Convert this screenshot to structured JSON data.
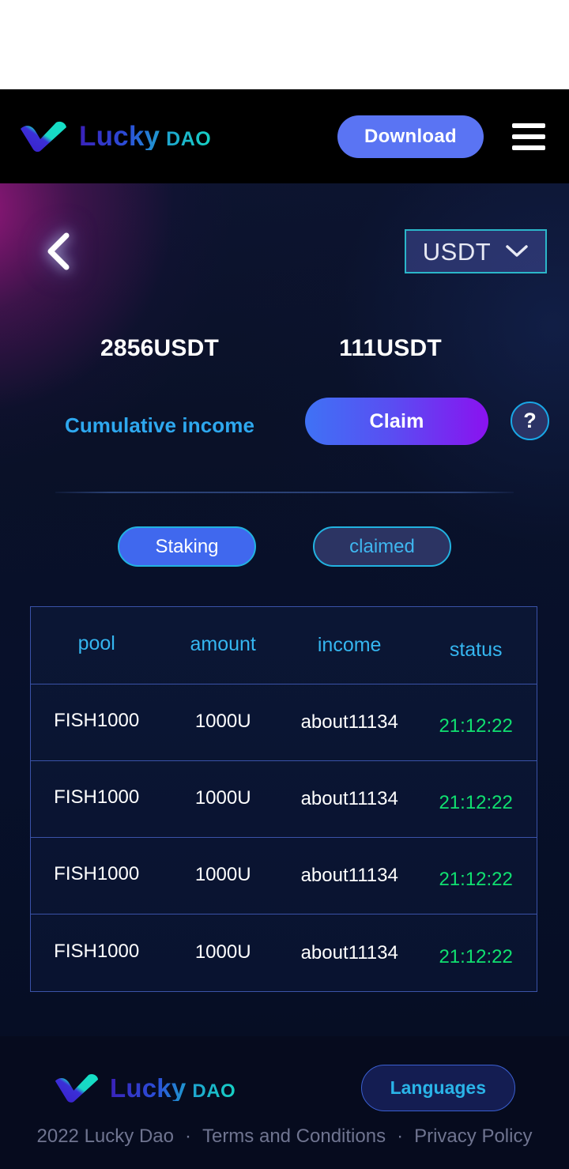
{
  "brand": {
    "name": "Lucky",
    "suffix": "DAO",
    "logo_icon": "checkmark-logo-icon"
  },
  "header": {
    "download_label": "Download",
    "menu_icon": "hamburger-menu-icon"
  },
  "hero": {
    "back_icon": "chevron-left-icon",
    "token_select": {
      "value": "USDT",
      "caret_icon": "chevron-down-icon"
    },
    "staked_amount": "2856USDT",
    "income_amount": "111USDT",
    "cumulative_label": "Cumulative income",
    "claim_label": "Claim",
    "help_label": "?"
  },
  "tabs": [
    {
      "label": "Staking",
      "active": true
    },
    {
      "label": "claimed",
      "active": false
    }
  ],
  "table": {
    "columns": [
      "pool",
      "amount",
      "income",
      "status"
    ],
    "rows": [
      {
        "pool": "FISH1000",
        "amount": "1000U",
        "income": "about11134",
        "status": "21:12:22"
      },
      {
        "pool": "FISH1000",
        "amount": "1000U",
        "income": "about11134",
        "status": "21:12:22"
      },
      {
        "pool": "FISH1000",
        "amount": "1000U",
        "income": "about11134",
        "status": "21:12:22"
      },
      {
        "pool": "FISH1000",
        "amount": "1000U",
        "income": "about11134",
        "status": "21:12:22"
      }
    ]
  },
  "footer": {
    "languages_label": "Languages",
    "copyright": "2022 Lucky Dao",
    "separator": "·",
    "terms_label": "Terms and Conditions",
    "privacy_label": "Privacy Policy"
  },
  "colors": {
    "accent_blue": "#5a74f3",
    "accent_cyan": "#2ab4e8",
    "status_green": "#10e070",
    "claim_gradient_start": "#3f72f5",
    "claim_gradient_end": "#8a12f0",
    "table_border": "#3a52a8"
  }
}
